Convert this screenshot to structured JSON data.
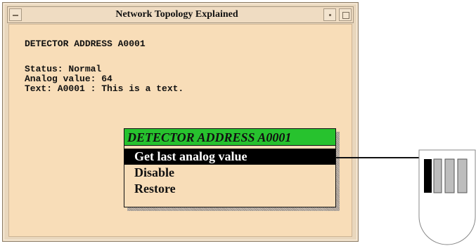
{
  "window": {
    "title": "Network Topology Explained"
  },
  "detector": {
    "header": "DETECTOR ADDRESS A0001",
    "status_line": "Status: Normal",
    "analog_line": "Analog value: 64",
    "text_line": "Text: A0001 : This is a text."
  },
  "context_menu": {
    "title": "DETECTOR ADDRESS A0001",
    "items": [
      {
        "label": "Get last analog value"
      },
      {
        "label": "Disable"
      },
      {
        "label": "Restore"
      }
    ]
  },
  "colors": {
    "window_bg": "#f8ddb8",
    "menu_header": "#27c22e",
    "selected_bg": "#000000"
  }
}
